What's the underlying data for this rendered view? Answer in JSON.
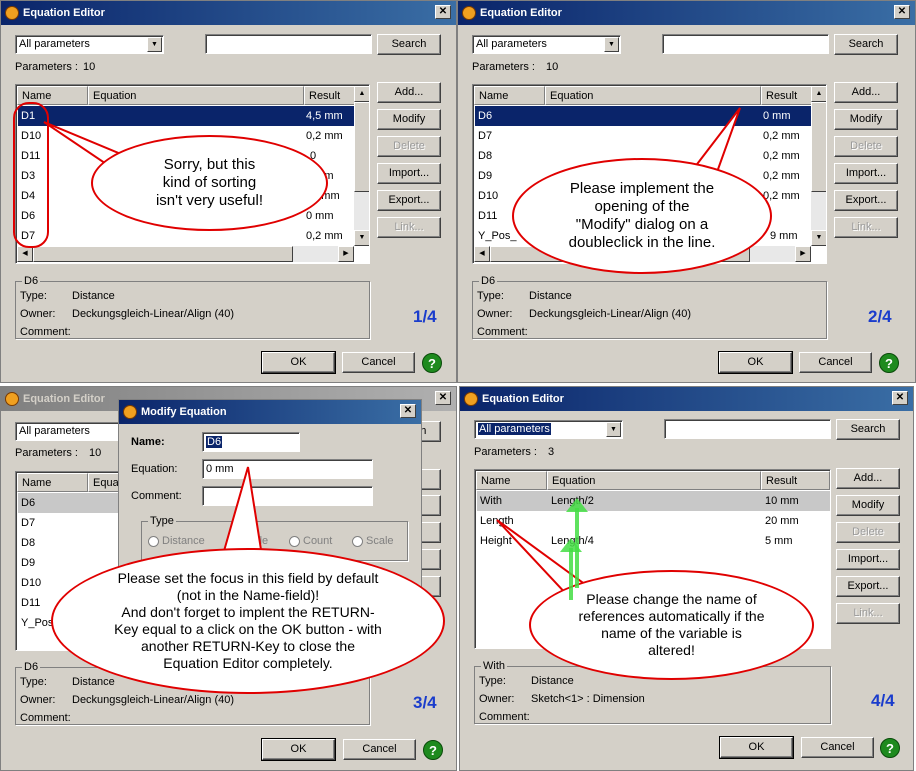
{
  "dialog_title": "Equation Editor",
  "modify_title": "Modify Equation",
  "filter_value": "All parameters",
  "search_label": "Search",
  "parameters_label": "Parameters :",
  "buttons": {
    "add": "Add...",
    "modify": "Modify",
    "delete": "Delete",
    "import": "Import...",
    "export": "Export...",
    "link": "Link...",
    "ok": "OK",
    "cancel": "Cancel"
  },
  "help_glyph": "?",
  "columns": {
    "name": "Name",
    "equation": "Equation",
    "result": "Result"
  },
  "info_labels": {
    "type": "Type:",
    "owner": "Owner:",
    "comment": "Comment:"
  },
  "panel1": {
    "count": "10",
    "rows": [
      {
        "name": "D1",
        "equation": "",
        "result": "4,5 mm"
      },
      {
        "name": "D10",
        "equation": "",
        "result": "0,2 mm"
      },
      {
        "name": "D11",
        "equation": "",
        "result": "0"
      },
      {
        "name": "D3",
        "equation": "",
        "result": "7 mm"
      },
      {
        "name": "D4",
        "equation": "",
        "result": "20 mm"
      },
      {
        "name": "D6",
        "equation": "",
        "result": "0 mm"
      },
      {
        "name": "D7",
        "equation": "",
        "result": "0,2 mm"
      }
    ],
    "info": {
      "group": "D6",
      "type": "Distance",
      "owner": "Deckungsgleich-Linear/Align (40)",
      "comment": ""
    },
    "step": "1/4",
    "note": [
      "Sorry, but this",
      "kind of sorting",
      "isn't very useful!"
    ]
  },
  "panel2": {
    "count": "10",
    "rows": [
      {
        "name": "D6",
        "equation": "",
        "result": "0 mm"
      },
      {
        "name": "D7",
        "equation": "",
        "result": "0,2 mm"
      },
      {
        "name": "D8",
        "equation": "",
        "result": "0,2 mm"
      },
      {
        "name": "D9",
        "equation": "",
        "result": "0,2 mm"
      },
      {
        "name": "D10",
        "equation": "",
        "result": "0,2 mm"
      },
      {
        "name": "D11",
        "equation": "",
        "result": ""
      },
      {
        "name": "Y_Pos_",
        "equation": "",
        "result": "9 mm"
      }
    ],
    "info": {
      "group": "D6",
      "type": "Distance",
      "owner": "Deckungsgleich-Linear/Align (40)",
      "comment": ""
    },
    "step": "2/4",
    "note": [
      "Please implement the",
      "opening of the",
      "\"Modify\" dialog on a",
      "doubleclick in the line."
    ]
  },
  "panel3": {
    "count": "10",
    "rows": [
      {
        "name": "D6"
      },
      {
        "name": "D7"
      },
      {
        "name": "D8"
      },
      {
        "name": "D9"
      },
      {
        "name": "D10"
      },
      {
        "name": "D11"
      },
      {
        "name": "Y_Pos_"
      }
    ],
    "info": {
      "group": "D6",
      "type": "Distance",
      "owner": "Deckungsgleich-Linear/Align (40)",
      "comment": ""
    },
    "step": "3/4",
    "modify": {
      "name_label": "Name:",
      "name_value": "D6",
      "equation_label": "Equation:",
      "equation_value": "0 mm",
      "comment_label": "Comment:",
      "comment_value": "",
      "type_group": "Type",
      "radios": [
        "Distance",
        "Angle",
        "Count",
        "Scale"
      ]
    },
    "note": [
      "Please set the focus in this field by default",
      "(not in the Name-field)!",
      "And don't forget to implent the RETURN-",
      "Key equal to a click on the OK button - with",
      "another RETURN-Key to close the",
      "Equation Editor completely."
    ]
  },
  "panel4": {
    "count": "3",
    "rows": [
      {
        "name": "With",
        "equation": "Length/2",
        "result": "10 mm"
      },
      {
        "name": "Length",
        "equation": "",
        "result": "20 mm"
      },
      {
        "name": "Height",
        "equation": "Length/4",
        "result": "5 mm"
      }
    ],
    "info": {
      "group": "With",
      "type": "Distance",
      "owner": "Sketch<1> : Dimension",
      "comment": ""
    },
    "step": "4/4",
    "note": [
      "Please change the name of",
      "references automatically if the",
      "name of the variable is",
      "altered!"
    ]
  },
  "colors": {
    "titlebar": "#0a246a",
    "dialog_bg": "#d4d0c8",
    "selection": "#0a246a",
    "annotation": "#e00000",
    "arrow": "#44dd44",
    "step_label": "#1a3ccc"
  }
}
